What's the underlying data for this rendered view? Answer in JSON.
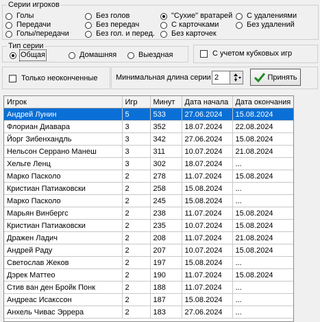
{
  "series_group": {
    "title": "Серии игроков",
    "options": [
      {
        "label": "Голы",
        "selected": false
      },
      {
        "label": "Передачи",
        "selected": false
      },
      {
        "label": "Голы/передачи",
        "selected": false
      },
      {
        "label": "Без голов",
        "selected": false
      },
      {
        "label": "Без передач",
        "selected": false
      },
      {
        "label": "Без гол. и перед.",
        "selected": false
      },
      {
        "label": "\"Сухие\" вратарей",
        "selected": true
      },
      {
        "label": "С карточками",
        "selected": false
      },
      {
        "label": "Без карточек",
        "selected": false
      },
      {
        "label": "С удалениями",
        "selected": false
      },
      {
        "label": "Без удалений",
        "selected": false
      }
    ]
  },
  "type_group": {
    "title": "Тип серии",
    "options": [
      {
        "label": "Общая",
        "selected": true
      },
      {
        "label": "Домашняя",
        "selected": false
      },
      {
        "label": "Выездная",
        "selected": false
      }
    ]
  },
  "cup_games_label": "С учетом кубковых игр",
  "unfinished_label": "Только неоконченные",
  "min_length_label": "Минимальная длина серии",
  "min_length_value": "2",
  "accept_label": "Принять",
  "table": {
    "columns": [
      "Игрок",
      "Игр",
      "Минут",
      "Дата начала",
      "Дата окончания"
    ],
    "selected_row": 0,
    "rows": [
      [
        "Андрей Лунин",
        "5",
        "533",
        "27.06.2024",
        "15.08.2024"
      ],
      [
        "Флориан Диавара",
        "3",
        "352",
        "18.07.2024",
        "22.08.2024"
      ],
      [
        "Йорг Зибенхандль",
        "3",
        "342",
        "27.06.2024",
        "15.08.2024"
      ],
      [
        "Нельсон Серрано Манеш",
        "3",
        "311",
        "10.07.2024",
        "21.08.2024"
      ],
      [
        "Хельге Ленц",
        "3",
        "302",
        "18.07.2024",
        "..."
      ],
      [
        "Марко Пасколо",
        "2",
        "278",
        "11.07.2024",
        "15.08.2024"
      ],
      [
        "Кристиан Патиаковски",
        "2",
        "258",
        "15.08.2024",
        "..."
      ],
      [
        "Марко Пасколо",
        "2",
        "245",
        "15.08.2024",
        "..."
      ],
      [
        "Марьян Винбергс",
        "2",
        "238",
        "11.07.2024",
        "15.08.2024"
      ],
      [
        "Кристиан Патиаковски",
        "2",
        "235",
        "10.07.2024",
        "15.08.2024"
      ],
      [
        "Дражен Ладич",
        "2",
        "208",
        "11.07.2024",
        "21.08.2024"
      ],
      [
        "Андрей Раду",
        "2",
        "207",
        "10.07.2024",
        "15.08.2024"
      ],
      [
        "Светослав Жеков",
        "2",
        "197",
        "15.08.2024",
        "..."
      ],
      [
        "Дэрек Маттео",
        "2",
        "190",
        "11.07.2024",
        "15.08.2024"
      ],
      [
        "Стив ван ден Бройк Понк",
        "2",
        "188",
        "11.07.2024",
        "..."
      ],
      [
        "Андреас Исакссон",
        "2",
        "187",
        "15.08.2024",
        "..."
      ],
      [
        "Анхель Чивас Эррера",
        "2",
        "183",
        "27.06.2024",
        "..."
      ]
    ]
  },
  "colors": {
    "selection": "#0a6fd6",
    "accept_icon": "#1e8c1e"
  }
}
